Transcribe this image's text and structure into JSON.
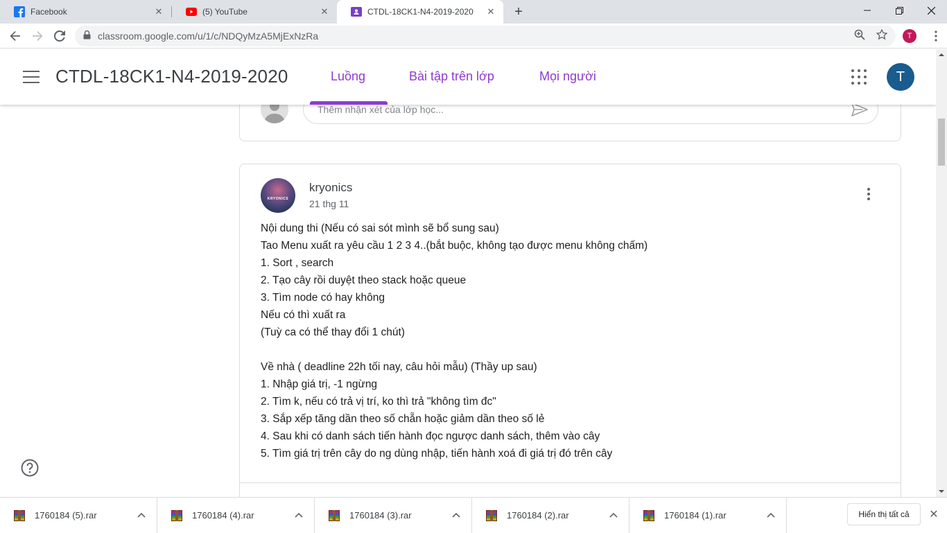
{
  "browser": {
    "tabs": [
      {
        "title": "Facebook",
        "icon": "facebook-icon"
      },
      {
        "title": "(5) YouTube",
        "icon": "youtube-icon"
      },
      {
        "title": "CTDL-18CK1-N4-2019-2020",
        "icon": "classroom-icon",
        "active": true
      }
    ],
    "url": "classroom.google.com/u/1/c/NDQyMzA5MjExNzRa",
    "profile_initial": "T"
  },
  "classroom": {
    "class_name": "CTDL-18CK1-N4-2019-2020",
    "nav_tabs": [
      "Luồng",
      "Bài tập trên lớp",
      "Mọi người"
    ],
    "active_tab": "Luồng",
    "user_initial": "T",
    "accent_color": "#8e3bd1"
  },
  "comment_box": {
    "placeholder": "Thêm nhận xét của lớp học..."
  },
  "post": {
    "author": "kryonics",
    "avatar_text": "KRYONICS",
    "date": "21 thg 11",
    "body_lines": [
      "Nội dung thi (Nếu có sai sót mình sẽ bổ sung sau)",
      "Tao Menu xuất ra yêu cầu 1 2 3 4..(bắt buộc, không tạo được menu không chấm)",
      "1. Sort , search",
      "2. Tạo cây rồi duyệt theo stack hoặc queue",
      "3. Tìm node có hay không",
      "Nếu có thì xuất ra",
      "(Tuỳ ca có thể thay đổi 1 chút)",
      "",
      "Về nhà ( deadline 22h tối nay, câu hỏi mẫu) (Thầy up sau)",
      "1. Nhập giá trị, -1 ngừng",
      "2. Tìm k, nếu có trả vị trí, ko thì trả \"không tìm đc\"",
      "3. Sắp xếp tăng dần theo số chẵn hoặc giảm dần theo số lẻ",
      "4. Sau khi có danh sách tiến hành đọc ngược danh sách, thêm vào cây",
      "5. Tìm giá trị trên cây do ng dùng nhập, tiến hành xoá đi giá trị đó trên cây"
    ]
  },
  "downloads": {
    "items": [
      "1760184 (5).rar",
      "1760184 (4).rar",
      "1760184 (3).rar",
      "1760184 (2).rar",
      "1760184 (1).rar"
    ],
    "show_all_label": "Hiển thị tất cả"
  }
}
